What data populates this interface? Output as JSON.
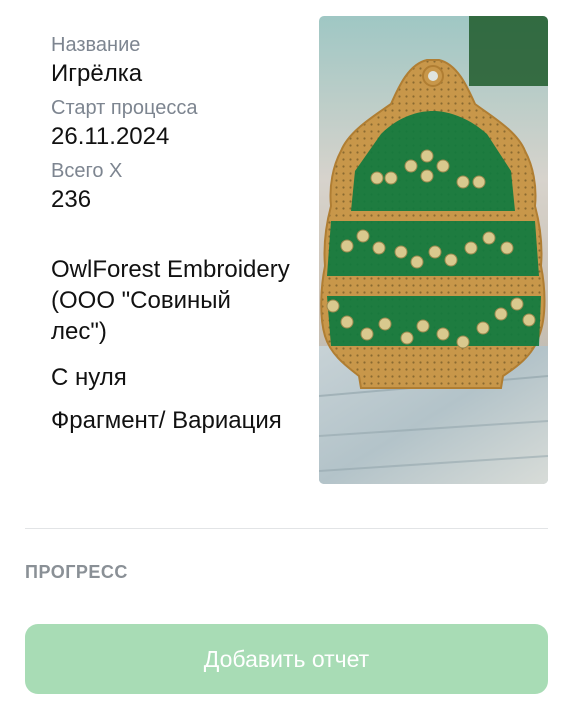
{
  "details": {
    "name_label": "Название",
    "name_value": "Игрёлка",
    "start_label": "Старт процесса",
    "start_value": "26.11.2024",
    "total_label": "Всего X",
    "total_value": "236",
    "manufacturer": "OwlForest Embroidery (ООО \"Совиный лес\")",
    "start_mode": "С нуля",
    "kind": "Фрагмент/ Вариация"
  },
  "photo": {
    "subject": "beaded cross-stitch christmas tree ornament on wooden base",
    "colors": {
      "wood_base": "#c89a45",
      "stitch_green": "#0f7a3f",
      "bead_gold": "#d9c98e",
      "background_table": "#b7c6cc"
    }
  },
  "progress": {
    "title": "ПРОГРЕСС"
  },
  "actions": {
    "add_report_label": "Добавить отчет"
  },
  "theme": {
    "accent_disabled": "#a8dcb5",
    "label_gray": "#7d8590"
  }
}
